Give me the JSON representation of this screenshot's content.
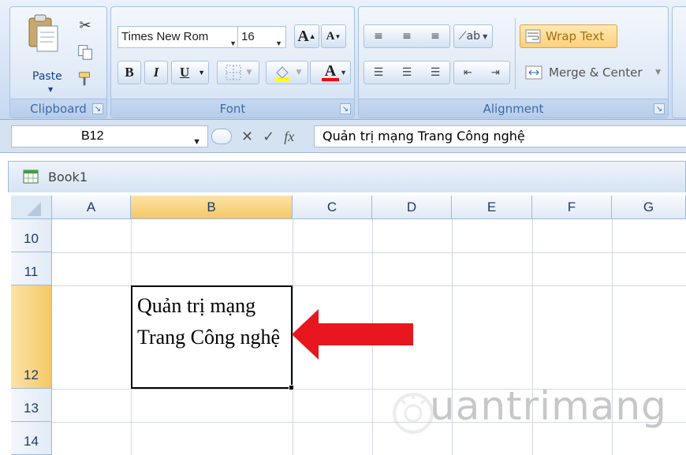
{
  "ribbon": {
    "clipboard": {
      "label": "Clipboard",
      "paste_label": "Paste"
    },
    "font": {
      "label": "Font",
      "font_name": "Times New Rom",
      "font_size": "16",
      "grow_label": "A",
      "shrink_label": "A",
      "bold_label": "B",
      "italic_label": "I",
      "underline_label": "U",
      "font_color_label": "A",
      "font_color": "#ff0000"
    },
    "alignment": {
      "label": "Alignment",
      "wrap_text_label": "Wrap Text",
      "merge_center_label": "Merge & Center",
      "wrap_text_active_color": "#ffd58a"
    }
  },
  "formula_bar": {
    "name_box": "B12",
    "formula": "Quản trị mạng Trang Công nghệ"
  },
  "workbook": {
    "title": "Book1",
    "columns": [
      "A",
      "B",
      "C",
      "D",
      "E",
      "F",
      "G"
    ],
    "rows": [
      "10",
      "11",
      "12",
      "13",
      "14"
    ],
    "active_cell": {
      "column": "B",
      "row": "12",
      "value": "Quản trị mạng Trang Công nghệ"
    },
    "selection_color": "#f5c766"
  },
  "annotation": {
    "arrow_color": "#e8161e"
  },
  "watermark": {
    "text": "uantrimang"
  }
}
